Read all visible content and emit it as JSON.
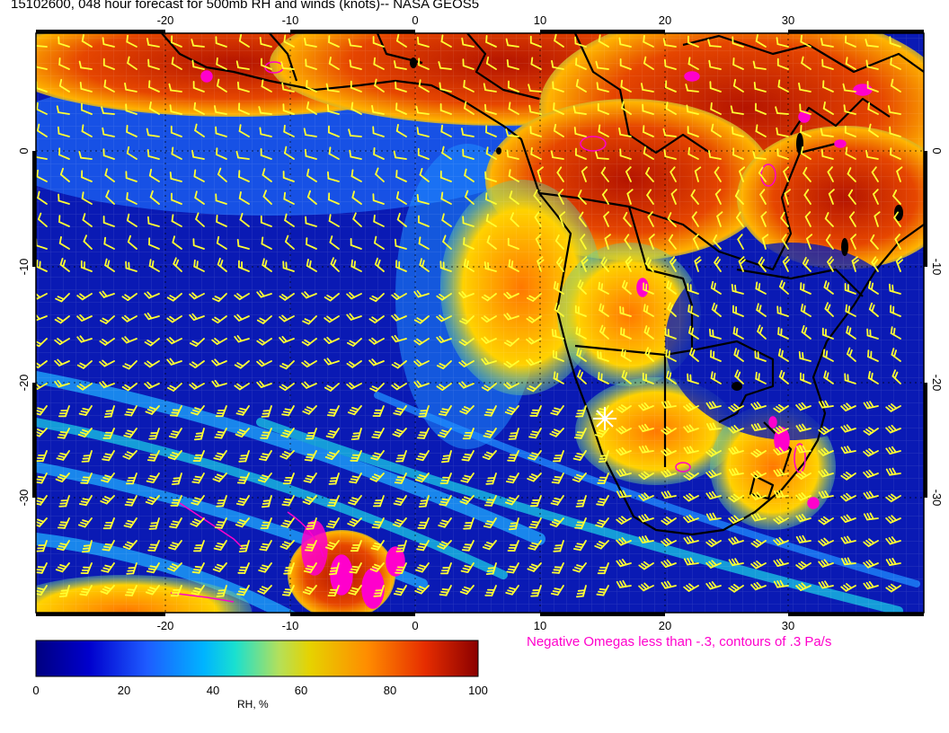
{
  "title": "15102600, 048 hour forecast for 500mb RH and winds (knots)-- NASA GEOS5",
  "map": {
    "lon_ticks": [
      "-20",
      "-10",
      "0",
      "10",
      "20",
      "30"
    ],
    "lat_ticks": [
      "0",
      "-10",
      "-20",
      "-30"
    ],
    "lon_range": [
      -30,
      42
    ],
    "lat_range": [
      -40,
      10
    ],
    "station_marker": "asterisk-icon",
    "barb_color": "#ffff33",
    "omega_color": "#ff00cc",
    "coast_color": "#000000"
  },
  "omega_note": "Negative Omegas less than -.3, contours of .3 Pa/s",
  "colorbar": {
    "title": "RH, %",
    "ticks": [
      "0",
      "20",
      "40",
      "60",
      "80",
      "100"
    ],
    "colors": [
      "#000080",
      "#0000cd",
      "#1e5bff",
      "#00b4ff",
      "#19e0d0",
      "#b4e05a",
      "#e6d200",
      "#ff8c00",
      "#e62d00",
      "#8b0000"
    ]
  }
}
